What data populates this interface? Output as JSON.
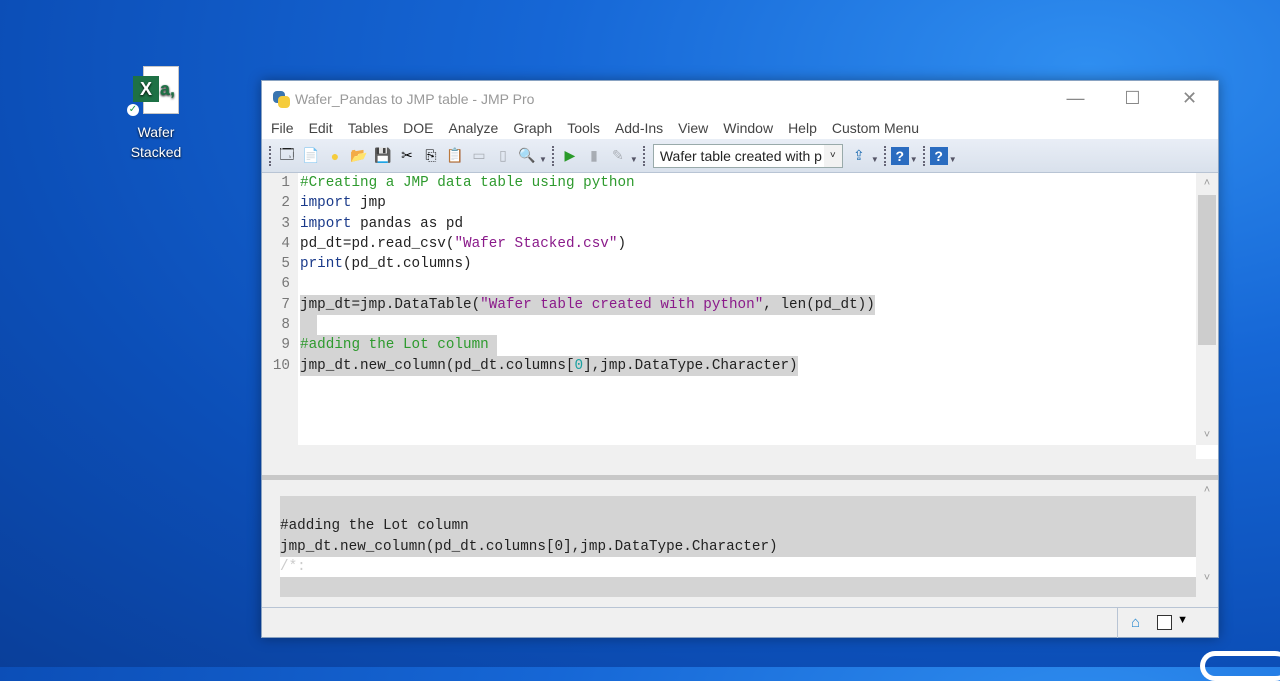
{
  "desktop": {
    "icon_label_1": "Wafer",
    "icon_label_2": "Stacked",
    "icon_glyph": "a,",
    "icon_letter": "X"
  },
  "window": {
    "title": "Wafer_Pandas to JMP table - JMP Pro",
    "minimize": "—",
    "maximize": "☐",
    "close": "✕"
  },
  "menu": [
    "File",
    "Edit",
    "Tables",
    "DOE",
    "Analyze",
    "Graph",
    "Tools",
    "Add-Ins",
    "View",
    "Window",
    "Help",
    "Custom Menu"
  ],
  "toolbar": {
    "table_combo": "Wafer table created with p",
    "combo_arrow": "˅"
  },
  "editor": {
    "lines": [
      {
        "n": "1",
        "hl": false,
        "tokens": [
          [
            "#Creating a JMP data table using python",
            "cm"
          ]
        ]
      },
      {
        "n": "2",
        "hl": false,
        "tokens": [
          [
            "import",
            "kw"
          ],
          [
            " jmp",
            "pl"
          ]
        ]
      },
      {
        "n": "3",
        "hl": false,
        "tokens": [
          [
            "import",
            "kw"
          ],
          [
            " pandas as pd",
            "pl"
          ]
        ]
      },
      {
        "n": "4",
        "hl": false,
        "tokens": [
          [
            "pd_dt=pd.read_csv(",
            "pl"
          ],
          [
            "\"Wafer Stacked.csv\"",
            "st"
          ],
          [
            ")",
            "pl"
          ]
        ]
      },
      {
        "n": "5",
        "hl": false,
        "tokens": [
          [
            "print",
            "kw"
          ],
          [
            "(pd_dt.columns)",
            "pl"
          ]
        ]
      },
      {
        "n": "6",
        "hl": false,
        "tokens": []
      },
      {
        "n": "7",
        "hl": true,
        "tokens": [
          [
            "jmp_dt=jmp.DataTable(",
            "pl"
          ],
          [
            "\"Wafer table created with python\"",
            "st"
          ],
          [
            ", len(pd_dt))",
            "pl"
          ]
        ]
      },
      {
        "n": "8",
        "hl": true,
        "tokens": [
          [
            "  ",
            "pl"
          ]
        ]
      },
      {
        "n": "9",
        "hl": true,
        "tokens": [
          [
            "#adding the Lot column ",
            "cm"
          ]
        ]
      },
      {
        "n": "10",
        "hl": true,
        "tokens": [
          [
            "jmp_dt.new_column(pd_dt.columns[",
            "pl"
          ],
          [
            "0",
            "nm"
          ],
          [
            "],jmp.DataType.Character)",
            "pl"
          ]
        ]
      }
    ]
  },
  "log": {
    "lines": [
      "",
      "#adding the Lot column",
      "jmp_dt.new_column(pd_dt.columns[0],jmp.DataType.Character)",
      "/*:",
      ""
    ]
  }
}
